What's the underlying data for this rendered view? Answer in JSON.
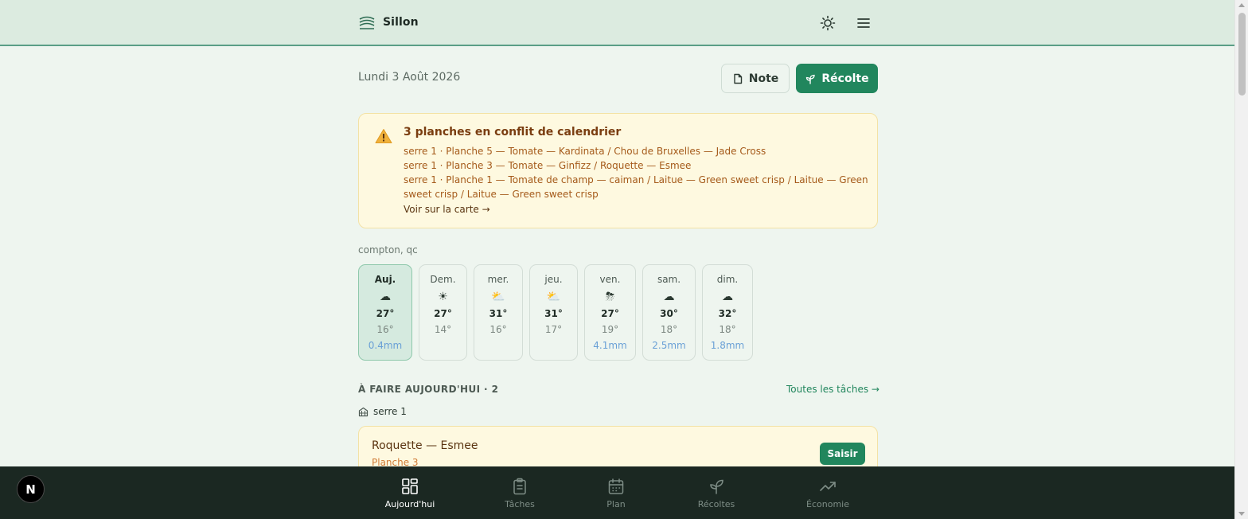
{
  "app": {
    "name": "Sillon"
  },
  "header": {
    "theme_icon": "sun-icon",
    "menu_icon": "hamburger-menu-icon"
  },
  "date": "Lundi 3 Août 2026",
  "actions": {
    "note_label": "Note",
    "recolte_label": "Récolte"
  },
  "alert": {
    "title": "3 planches en conflit de calendrier",
    "lines": [
      "serre 1 · Planche 5 — Tomate — Kardinata / Chou de Bruxelles — Jade Cross",
      "serre 1 · Planche 3 — Tomate — Ginfizz / Roquette — Esmee",
      "serre 1 · Planche 1 — Tomate de champ — caiman / Laitue — Green sweet crisp / Laitue — Green sweet crisp / Laitue — Green sweet crisp"
    ],
    "link": "Voir sur la carte →"
  },
  "weather": {
    "location": "compton, qc",
    "days": [
      {
        "label": "Auj.",
        "icon": "☁",
        "hi": "27°",
        "lo": "16°",
        "rain": "0.4mm"
      },
      {
        "label": "Dem.",
        "icon": "☀",
        "hi": "27°",
        "lo": "14°",
        "rain": ""
      },
      {
        "label": "mer.",
        "icon": "⛅",
        "hi": "31°",
        "lo": "16°",
        "rain": ""
      },
      {
        "label": "jeu.",
        "icon": "⛅",
        "hi": "31°",
        "lo": "17°",
        "rain": ""
      },
      {
        "label": "ven.",
        "icon": "⛈",
        "hi": "27°",
        "lo": "19°",
        "rain": "4.1mm"
      },
      {
        "label": "sam.",
        "icon": "☁",
        "hi": "30°",
        "lo": "18°",
        "rain": "2.5mm"
      },
      {
        "label": "dim.",
        "icon": "☁",
        "hi": "32°",
        "lo": "18°",
        "rain": "1.8mm"
      }
    ]
  },
  "tasks": {
    "title": "À FAIRE AUJOURD'HUI · 2",
    "all_link": "Toutes les tâches →",
    "group": "serre 1",
    "items": [
      {
        "title": "Roquette — Esmee",
        "subtitle": "Planche 3",
        "action": "Saisir"
      }
    ]
  },
  "nav": [
    {
      "label": "Aujourd'hui",
      "icon": "dashboard-icon",
      "active": true
    },
    {
      "label": "Tâches",
      "icon": "clipboard-icon",
      "active": false
    },
    {
      "label": "Plan",
      "icon": "calendar-icon",
      "active": false
    },
    {
      "label": "Récoltes",
      "icon": "sprout-icon",
      "active": false
    },
    {
      "label": "Économie",
      "icon": "trend-icon",
      "active": false
    }
  ],
  "badge": "N",
  "colors": {
    "accent": "#21865d",
    "header_bg": "#dcebe0",
    "nav_bg": "#1b2822",
    "alert_bg": "#fef9e0"
  }
}
